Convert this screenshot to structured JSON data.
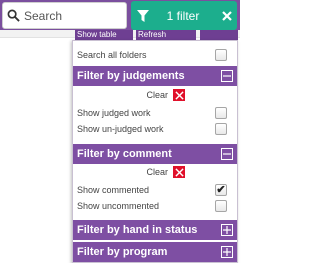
{
  "search": {
    "placeholder": "Search",
    "icon": "search-icon"
  },
  "filter_button": {
    "label": "1 filter",
    "color": "#1cae8d"
  },
  "toolbar": {
    "btn_a": "Show table",
    "btn_b": "Refresh",
    "btn_c": ""
  },
  "panel": {
    "search_all_folders": "Search all folders",
    "clear_label": "Clear",
    "sections": {
      "judgements": {
        "title": "Filter by judgements",
        "expanded": true,
        "options": [
          {
            "label": "Show judged work",
            "checked": false
          },
          {
            "label": "Show un-judged work",
            "checked": false
          }
        ]
      },
      "comment": {
        "title": "Filter by comment",
        "expanded": true,
        "options": [
          {
            "label": "Show commented",
            "checked": true
          },
          {
            "label": "Show uncommented",
            "checked": false
          }
        ]
      },
      "hand_in": {
        "title": "Filter by hand in status",
        "expanded": false
      },
      "program": {
        "title": "Filter by program",
        "expanded": false
      }
    }
  },
  "colors": {
    "header_purple": "#7e4fa3",
    "clear_red": "#e0102a",
    "accent_green": "#1cae8d"
  }
}
